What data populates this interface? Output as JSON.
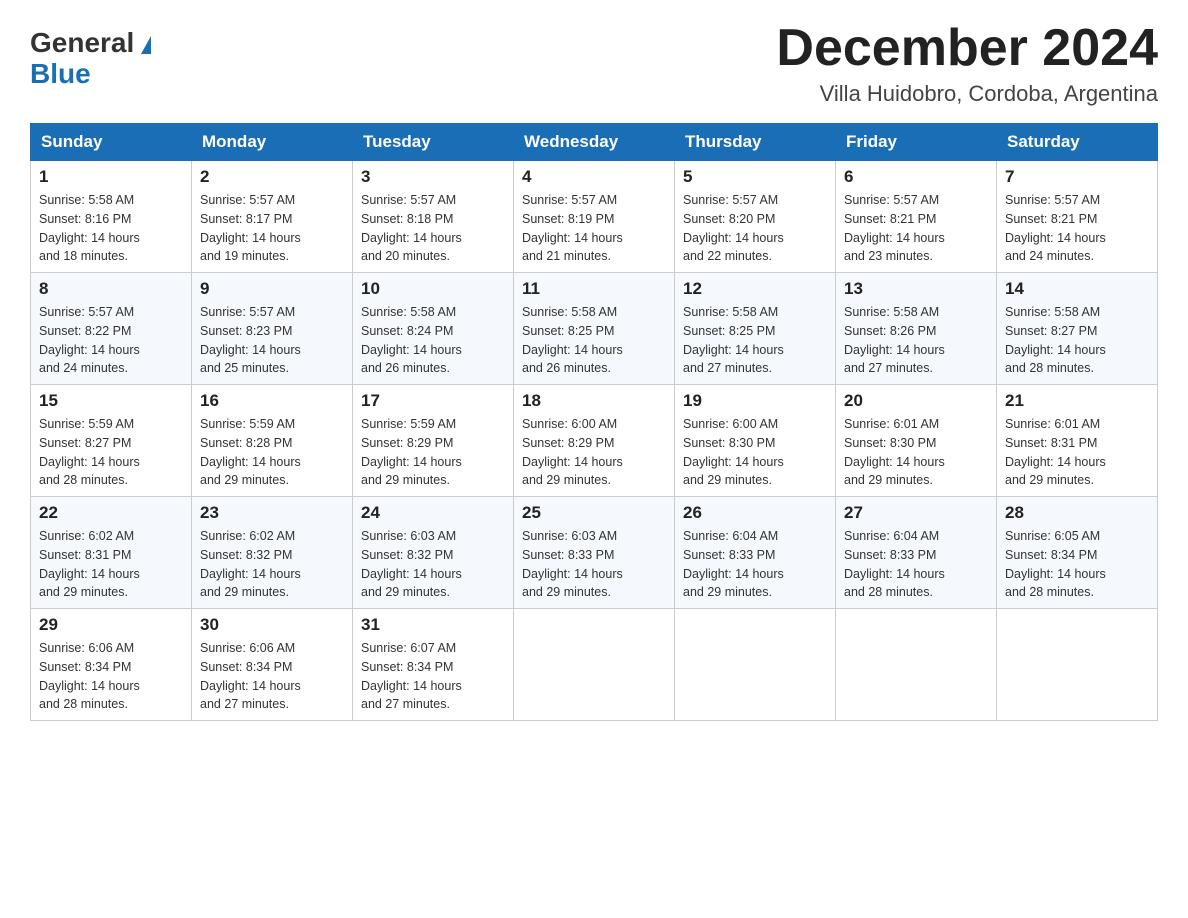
{
  "header": {
    "logo_general": "General",
    "logo_blue": "Blue",
    "month_title": "December 2024",
    "location": "Villa Huidobro, Cordoba, Argentina"
  },
  "days_of_week": [
    "Sunday",
    "Monday",
    "Tuesday",
    "Wednesday",
    "Thursday",
    "Friday",
    "Saturday"
  ],
  "weeks": [
    [
      {
        "day": "1",
        "sunrise": "5:58 AM",
        "sunset": "8:16 PM",
        "daylight": "14 hours and 18 minutes."
      },
      {
        "day": "2",
        "sunrise": "5:57 AM",
        "sunset": "8:17 PM",
        "daylight": "14 hours and 19 minutes."
      },
      {
        "day": "3",
        "sunrise": "5:57 AM",
        "sunset": "8:18 PM",
        "daylight": "14 hours and 20 minutes."
      },
      {
        "day": "4",
        "sunrise": "5:57 AM",
        "sunset": "8:19 PM",
        "daylight": "14 hours and 21 minutes."
      },
      {
        "day": "5",
        "sunrise": "5:57 AM",
        "sunset": "8:20 PM",
        "daylight": "14 hours and 22 minutes."
      },
      {
        "day": "6",
        "sunrise": "5:57 AM",
        "sunset": "8:21 PM",
        "daylight": "14 hours and 23 minutes."
      },
      {
        "day": "7",
        "sunrise": "5:57 AM",
        "sunset": "8:21 PM",
        "daylight": "14 hours and 24 minutes."
      }
    ],
    [
      {
        "day": "8",
        "sunrise": "5:57 AM",
        "sunset": "8:22 PM",
        "daylight": "14 hours and 24 minutes."
      },
      {
        "day": "9",
        "sunrise": "5:57 AM",
        "sunset": "8:23 PM",
        "daylight": "14 hours and 25 minutes."
      },
      {
        "day": "10",
        "sunrise": "5:58 AM",
        "sunset": "8:24 PM",
        "daylight": "14 hours and 26 minutes."
      },
      {
        "day": "11",
        "sunrise": "5:58 AM",
        "sunset": "8:25 PM",
        "daylight": "14 hours and 26 minutes."
      },
      {
        "day": "12",
        "sunrise": "5:58 AM",
        "sunset": "8:25 PM",
        "daylight": "14 hours and 27 minutes."
      },
      {
        "day": "13",
        "sunrise": "5:58 AM",
        "sunset": "8:26 PM",
        "daylight": "14 hours and 27 minutes."
      },
      {
        "day": "14",
        "sunrise": "5:58 AM",
        "sunset": "8:27 PM",
        "daylight": "14 hours and 28 minutes."
      }
    ],
    [
      {
        "day": "15",
        "sunrise": "5:59 AM",
        "sunset": "8:27 PM",
        "daylight": "14 hours and 28 minutes."
      },
      {
        "day": "16",
        "sunrise": "5:59 AM",
        "sunset": "8:28 PM",
        "daylight": "14 hours and 29 minutes."
      },
      {
        "day": "17",
        "sunrise": "5:59 AM",
        "sunset": "8:29 PM",
        "daylight": "14 hours and 29 minutes."
      },
      {
        "day": "18",
        "sunrise": "6:00 AM",
        "sunset": "8:29 PM",
        "daylight": "14 hours and 29 minutes."
      },
      {
        "day": "19",
        "sunrise": "6:00 AM",
        "sunset": "8:30 PM",
        "daylight": "14 hours and 29 minutes."
      },
      {
        "day": "20",
        "sunrise": "6:01 AM",
        "sunset": "8:30 PM",
        "daylight": "14 hours and 29 minutes."
      },
      {
        "day": "21",
        "sunrise": "6:01 AM",
        "sunset": "8:31 PM",
        "daylight": "14 hours and 29 minutes."
      }
    ],
    [
      {
        "day": "22",
        "sunrise": "6:02 AM",
        "sunset": "8:31 PM",
        "daylight": "14 hours and 29 minutes."
      },
      {
        "day": "23",
        "sunrise": "6:02 AM",
        "sunset": "8:32 PM",
        "daylight": "14 hours and 29 minutes."
      },
      {
        "day": "24",
        "sunrise": "6:03 AM",
        "sunset": "8:32 PM",
        "daylight": "14 hours and 29 minutes."
      },
      {
        "day": "25",
        "sunrise": "6:03 AM",
        "sunset": "8:33 PM",
        "daylight": "14 hours and 29 minutes."
      },
      {
        "day": "26",
        "sunrise": "6:04 AM",
        "sunset": "8:33 PM",
        "daylight": "14 hours and 29 minutes."
      },
      {
        "day": "27",
        "sunrise": "6:04 AM",
        "sunset": "8:33 PM",
        "daylight": "14 hours and 28 minutes."
      },
      {
        "day": "28",
        "sunrise": "6:05 AM",
        "sunset": "8:34 PM",
        "daylight": "14 hours and 28 minutes."
      }
    ],
    [
      {
        "day": "29",
        "sunrise": "6:06 AM",
        "sunset": "8:34 PM",
        "daylight": "14 hours and 28 minutes."
      },
      {
        "day": "30",
        "sunrise": "6:06 AM",
        "sunset": "8:34 PM",
        "daylight": "14 hours and 27 minutes."
      },
      {
        "day": "31",
        "sunrise": "6:07 AM",
        "sunset": "8:34 PM",
        "daylight": "14 hours and 27 minutes."
      },
      null,
      null,
      null,
      null
    ]
  ],
  "labels": {
    "sunrise": "Sunrise:",
    "sunset": "Sunset:",
    "daylight": "Daylight:"
  }
}
